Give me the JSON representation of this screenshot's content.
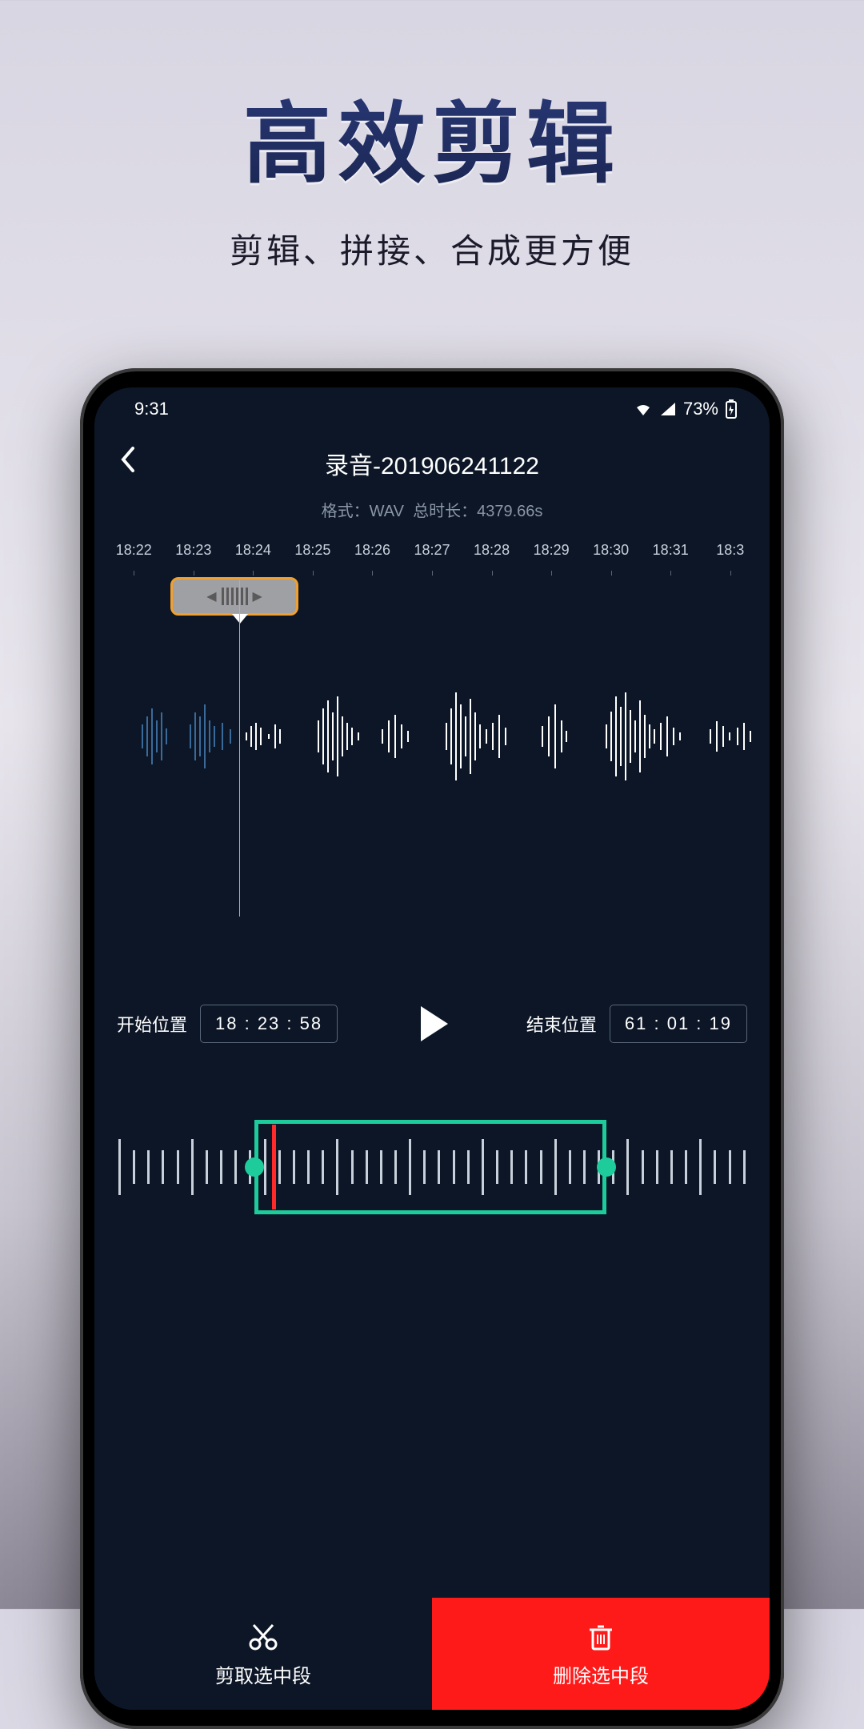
{
  "marketing": {
    "title": "高效剪辑",
    "subtitle": "剪辑、拼接、合成更方便"
  },
  "status_bar": {
    "time": "9:31",
    "battery": "73%"
  },
  "header": {
    "title": "录音-201906241122",
    "format_label": "格式：",
    "format_value": "WAV",
    "duration_label": "总时长：",
    "duration_value": "4379.66s"
  },
  "ruler_ticks": [
    "18:22",
    "18:23",
    "18:24",
    "18:25",
    "18:26",
    "18:27",
    "18:28",
    "18:29",
    "18:30",
    "18:31",
    "18:3"
  ],
  "controls": {
    "start_label": "开始位置",
    "start_value": "18 : 23 : 58",
    "end_label": "结束位置",
    "end_value": "61 : 01 : 19"
  },
  "actions": {
    "cut": "剪取选中段",
    "delete": "删除选中段"
  },
  "colors": {
    "accent": "#1ecb9b",
    "danger": "#ff1a1a",
    "highlight": "#f0a030"
  }
}
